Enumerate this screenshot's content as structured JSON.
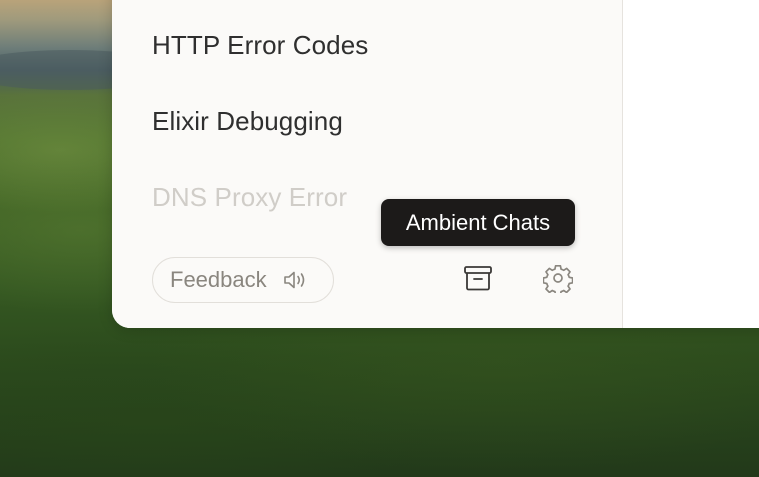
{
  "sidebar": {
    "chats": [
      {
        "title": "HTTP Error Codes"
      },
      {
        "title": "Elixir Debugging"
      },
      {
        "title": "DNS Proxy Error"
      }
    ],
    "footer": {
      "feedback_label": "Feedback",
      "feedback_icon": "speaker-icon",
      "archive_icon": "archive-box-icon",
      "settings_icon": "gear-icon"
    }
  },
  "tooltip": {
    "text": "Ambient Chats"
  },
  "colors": {
    "panel_background": "#fbfaf8",
    "tooltip_background": "#1c1a19",
    "text_primary": "#2f2f2f",
    "text_faded": "#d0cdc8",
    "icon_color": "#8a867f"
  }
}
